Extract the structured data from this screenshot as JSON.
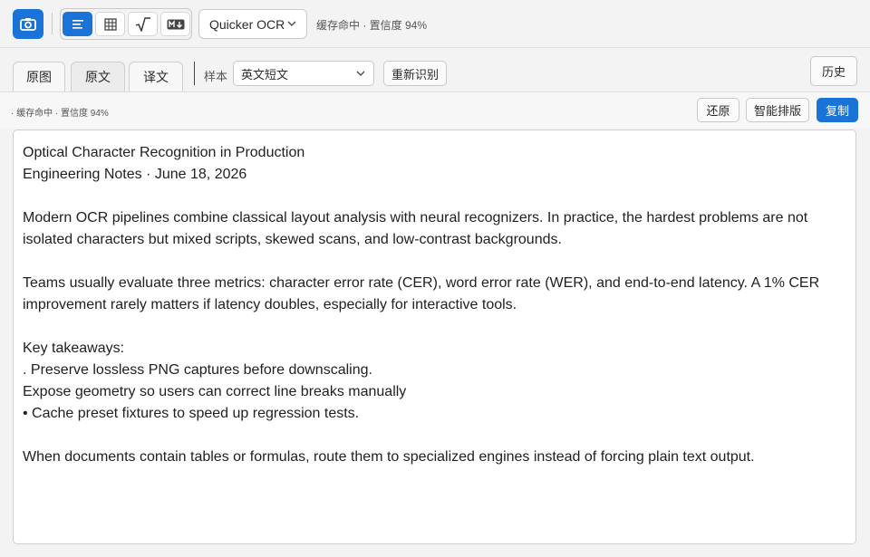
{
  "toolbar": {
    "capture_icon": "camera-icon",
    "modes": [
      {
        "name": "text-mode",
        "icon": "align-left-icon",
        "active": true
      },
      {
        "name": "table-mode",
        "icon": "table-grid-icon",
        "active": false
      },
      {
        "name": "formula-mode",
        "icon": "sqrt-icon",
        "active": false
      },
      {
        "name": "markdown-mode",
        "icon": "markdown-icon",
        "active": false
      }
    ],
    "engine_value": "Quicker OCR",
    "status": "缓存命中 · 置信度 94%"
  },
  "tabs": [
    {
      "label": "原图",
      "active": false
    },
    {
      "label": "原文",
      "active": true
    },
    {
      "label": "译文",
      "active": false
    }
  ],
  "sample": {
    "label": "样本",
    "value": "英文短文",
    "rerecognize_label": "重新识别"
  },
  "history_label": "历史",
  "sub_status": "· 缓存命中 · 置信度 94%",
  "actions": {
    "restore_label": "还原",
    "smart_layout_label": "智能排版",
    "copy_label": "复制"
  },
  "content": {
    "lines": [
      "Optical Character Recognition in Production",
      "Engineering Notes · June 18, 2026",
      "",
      "Modern OCR pipelines combine classical layout analysis with neural recognizers. In practice, the hardest problems are not",
      "isolated characters but mixed scripts, skewed scans, and low-contrast backgrounds.",
      "",
      "Teams usually evaluate three metrics: character error rate (CER), word error rate (WER), and end-to-end latency. A 1% CER",
      "improvement rarely matters if latency doubles, especially for interactive tools.",
      "",
      "Key takeaways:",
      ". Preserve lossless PNG captures before downscaling.",
      "Expose geometry so users can correct line breaks manually",
      "• Cache preset fixtures to speed up regression tests.",
      "",
      "When documents contain tables or formulas, route them to specialized engines instead of forcing plain text output."
    ]
  },
  "colors": {
    "accent": "#1a73d6"
  }
}
